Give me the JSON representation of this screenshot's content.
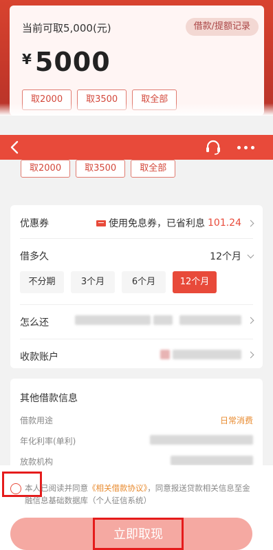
{
  "top_card": {
    "available_text": "当前可取5,000(元)",
    "records_button": "借款/提额记录",
    "currency": "¥",
    "amount": "5000"
  },
  "quick_amounts": [
    "取2000",
    "取3500",
    "取全部"
  ],
  "header": {
    "back_icon": "chevron-left-icon",
    "support_icon": "headset-icon",
    "more_icon": "more-horizontal-icon",
    "background": "#e84a3a"
  },
  "coupon": {
    "label": "优惠券",
    "text": "使用免息券，已省利息",
    "saved": "101.24"
  },
  "term": {
    "label": "借多久",
    "selected": "12个月",
    "options": [
      "不分期",
      "3个月",
      "6个月",
      "12个月"
    ]
  },
  "repay": {
    "label": "怎么还"
  },
  "account": {
    "label": "收款账户"
  },
  "other_info": {
    "title": "其他借款信息",
    "purpose_label": "借款用途",
    "purpose_value": "日常消费",
    "rate_label": "年化利率(单利)",
    "lender_label": "放款机构"
  },
  "agreement": {
    "prefix": "本人已阅读并同意",
    "link": "《相关借款协议》",
    "suffix": "，同意报送贷款相关信息至金融信息基础数据库（个人征信系统）"
  },
  "submit": {
    "label": "立即取现"
  },
  "colors": {
    "accent": "#e84a3a",
    "highlight": "#e51b1b",
    "orange": "#e88a2e"
  }
}
